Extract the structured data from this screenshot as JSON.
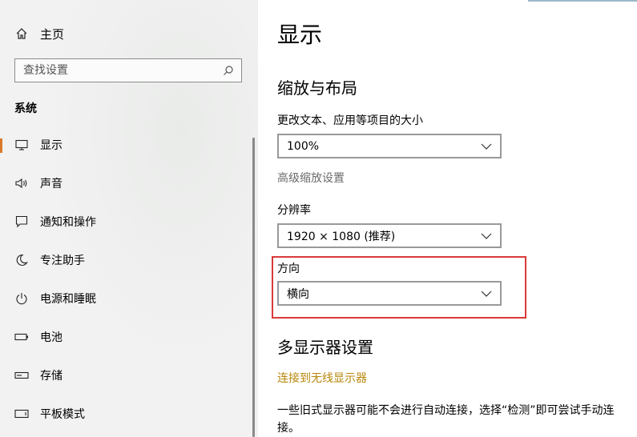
{
  "sidebar": {
    "home_label": "主页",
    "search_placeholder": "查找设置",
    "section_label": "系统",
    "items": [
      {
        "label": "显示",
        "icon": "monitor-icon",
        "selected": true
      },
      {
        "label": "声音",
        "icon": "speaker-icon"
      },
      {
        "label": "通知和操作",
        "icon": "notification-icon"
      },
      {
        "label": "专注助手",
        "icon": "moon-icon"
      },
      {
        "label": "电源和睡眠",
        "icon": "power-icon"
      },
      {
        "label": "电池",
        "icon": "battery-icon"
      },
      {
        "label": "存储",
        "icon": "storage-icon"
      },
      {
        "label": "平板模式",
        "icon": "tablet-icon"
      }
    ]
  },
  "main": {
    "title": "显示",
    "scale_layout_heading": "缩放与布局",
    "text_size_label": "更改文本、应用等项目的大小",
    "text_size_value": "100%",
    "advanced_scaling_link": "高级缩放设置",
    "resolution_label": "分辨率",
    "resolution_value": "1920 × 1080 (推荐)",
    "orientation_label": "方向",
    "orientation_value": "横向",
    "multi_display_heading": "多显示器设置",
    "wireless_link": "连接到无线显示器",
    "paragraph": "一些旧式显示器可能不会进行自动连接，选择“检测”即可尝试手动连接。"
  },
  "colors": {
    "selected_indicator": "#d97a2b",
    "link_gold": "#b8860b",
    "highlight_border": "#d93a3a"
  }
}
